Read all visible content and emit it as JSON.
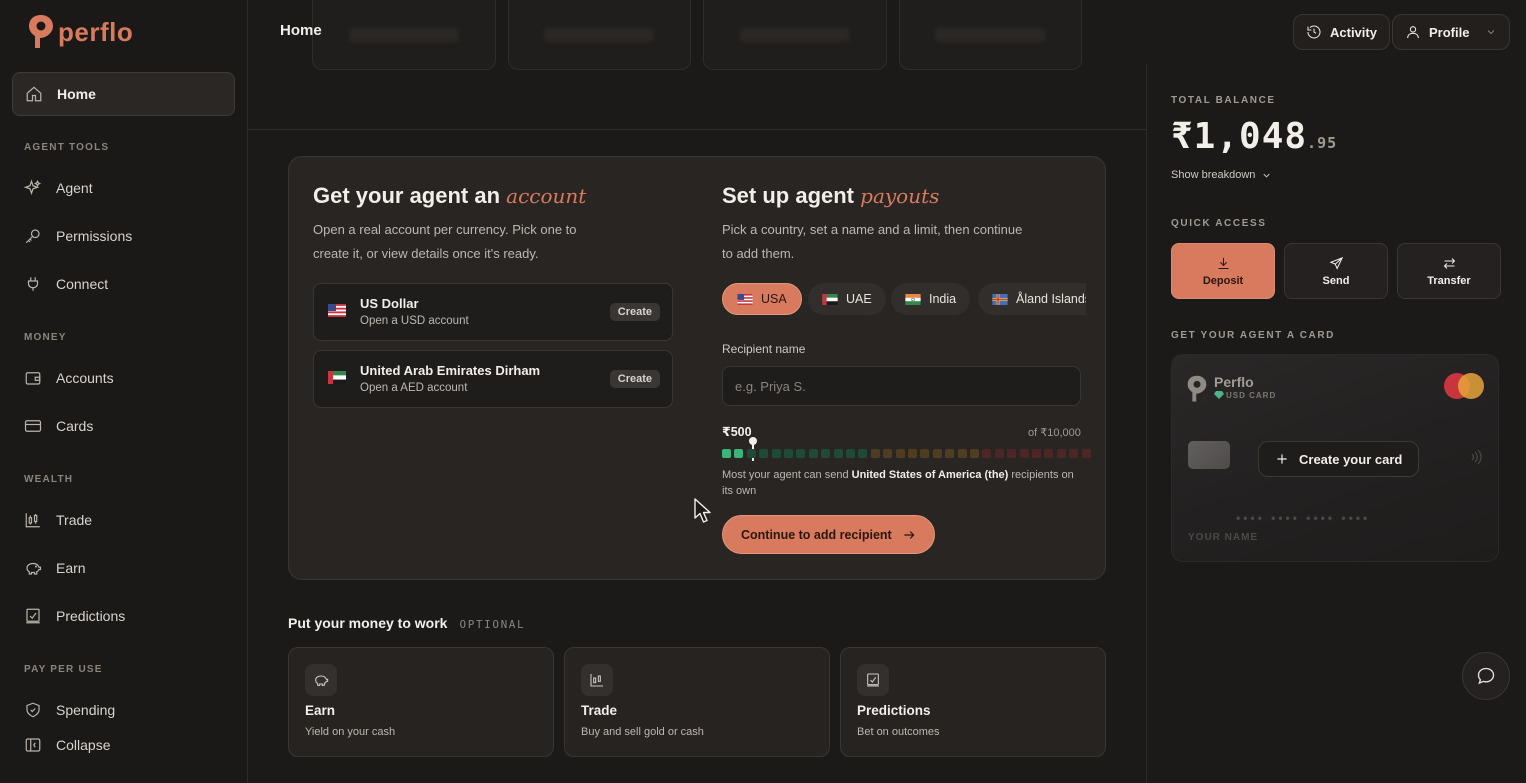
{
  "brand": {
    "name": "perflo"
  },
  "sidebar": {
    "home": "Home",
    "sections": [
      {
        "label": "AGENT TOOLS",
        "items": [
          "Agent",
          "Permissions",
          "Connect"
        ]
      },
      {
        "label": "MONEY",
        "items": [
          "Accounts",
          "Cards"
        ]
      },
      {
        "label": "WEALTH",
        "items": [
          "Trade",
          "Earn",
          "Predictions"
        ]
      },
      {
        "label": "PAY PER USE",
        "items": [
          "Spending"
        ]
      }
    ],
    "collapse": "Collapse"
  },
  "topbar": {
    "title": "Home",
    "activity": "Activity",
    "profile": "Profile"
  },
  "account_panel": {
    "heading_plain": "Get your agent an",
    "heading_accent": "account",
    "description": "Open a real account per currency. Pick one to create it, or view details once it's ready.",
    "accounts": [
      {
        "name": "US Dollar",
        "sub": "Open a USD account",
        "action": "Create"
      },
      {
        "name": "United Arab Emirates Dirham",
        "sub": "Open a AED account",
        "action": "Create"
      }
    ]
  },
  "payouts_panel": {
    "heading_plain": "Set up agent",
    "heading_accent": "payouts",
    "description": "Pick a country, set a name and a limit, then continue to add them.",
    "countries": [
      "USA",
      "UAE",
      "India",
      "Åland Islands"
    ],
    "selected_country": "USA",
    "recipient_label": "Recipient name",
    "recipient_placeholder": "e.g. Priya S.",
    "recipient_value": "",
    "limit_value": "₹500",
    "limit_max": "of ₹10,000",
    "limit_fraction": 0.05,
    "note_prefix": "Most your agent can send",
    "note_bold": "United States of America (the)",
    "note_suffix": "recipients on its own",
    "continue_label": "Continue to add recipient"
  },
  "work": {
    "title": "Put your money to work",
    "optional": "OPTIONAL",
    "cards": [
      {
        "title": "Earn",
        "sub": "Yield on your cash"
      },
      {
        "title": "Trade",
        "sub": "Buy and sell gold or cash"
      },
      {
        "title": "Predictions",
        "sub": "Bet on outcomes"
      }
    ]
  },
  "right_panel": {
    "balance_label": "TOTAL BALANCE",
    "balance_main": "₹1,048",
    "balance_cents": ".95",
    "breakdown": "Show breakdown",
    "quick_access_label": "QUICK ACCESS",
    "quick_actions": [
      "Deposit",
      "Send",
      "Transfer"
    ],
    "card_label": "GET YOUR AGENT A CARD",
    "card": {
      "brand": "Perflo",
      "sub": "USD CARD",
      "create": "Create your card",
      "number": "•••• •••• •••• ••••",
      "name": "YOUR NAME"
    }
  },
  "colors": {
    "accent": "#d77a5e",
    "background": "#1c1a18",
    "panel": "#282523"
  }
}
